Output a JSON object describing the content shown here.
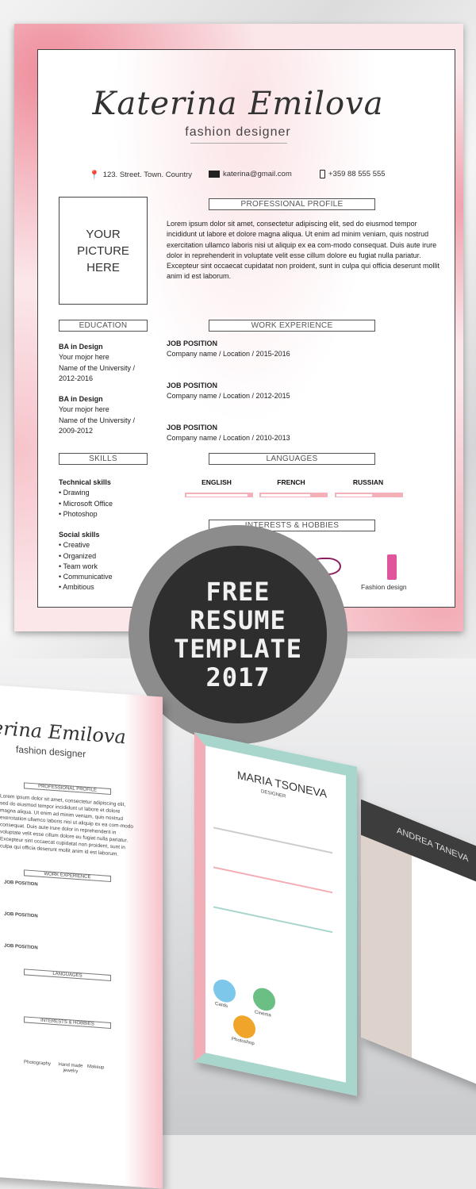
{
  "resume": {
    "name": "Katerina Emilova",
    "title": "fashion designer",
    "contact": {
      "address": "123. Street. Town. Country",
      "email": "katerina@gmail.com",
      "phone": "+359 88 555 555"
    },
    "photo_placeholder": [
      "YOUR",
      "PICTURE",
      "HERE"
    ],
    "sections": {
      "profile": "PROFESSIONAL PROFILE",
      "education": "EDUCATION",
      "work": "WORK EXPERIENCE",
      "skills": "SKILLS",
      "languages": "LANGUAGES",
      "interests": "INTERESTS & HOBBIES"
    },
    "profile_text": "Lorem ipsum dolor sit amet, consectetur adipiscing elit, sed do eiusmod tempor incididunt ut labore et dolore magna aliqua. Ut enim ad minim veniam, quis nostrud exercitation ullamco laboris nisi ut aliquip ex ea com-modo consequat. Duis aute irure dolor in reprehenderit in voluptate velit esse cillum dolore eu fugiat nulla pariatur. Excepteur sint occaecat cupidatat non proident, sunt in culpa qui officia deserunt mollit anim id est laborum.",
    "education": [
      {
        "degree": "BA in Design",
        "major": "Your mojor here",
        "university": "Name of the University /",
        "years": "2012-2016"
      },
      {
        "degree": "BA in Design",
        "major": "Your mojor here",
        "university": "Name of the University /",
        "years": "2009-2012"
      }
    ],
    "work": [
      {
        "position": "JOB POSITION",
        "details": "Company name / Location / 2015-2016"
      },
      {
        "position": "JOB POSITION",
        "details": "Company name / Location / 2012-2015"
      },
      {
        "position": "JOB POSITION",
        "details": "Company name / Location / 2010-2013"
      }
    ],
    "skills": {
      "technical_title": "Technical skills",
      "technical": [
        "• Drawing",
        "• Microsoft Office",
        "• Photoshop"
      ],
      "social_title": "Social skills",
      "social": [
        "• Creative",
        "• Organized",
        "• Team work",
        "• Communicative",
        "• Ambitious"
      ]
    },
    "languages": [
      {
        "name": "ENGLISH",
        "level": 0.93
      },
      {
        "name": "FRENCH",
        "level": 0.75
      },
      {
        "name": "RUSSIAN",
        "level": 0.55
      }
    ],
    "hobbies": [
      "Photography",
      "Hand made jewelry",
      "Makeup",
      "Fashion design"
    ]
  },
  "badge": {
    "lines": [
      "FREE",
      "RESUME",
      "TEMPLATE",
      "2017"
    ]
  },
  "mockups": {
    "left": {
      "name": "erina Emilova",
      "title": "fashion designer"
    },
    "middle": {
      "name": "MARIA TSONEVA",
      "title": "DESIGNER",
      "hobbies": [
        "Cards",
        "Cinema",
        "Photoshop"
      ]
    },
    "right": {
      "name": "ANDREA TANEVA"
    }
  },
  "colors": {
    "accent_pink": "#f5b1ba",
    "mint": "#a9d6cc",
    "dark": "#2e2e2e"
  }
}
